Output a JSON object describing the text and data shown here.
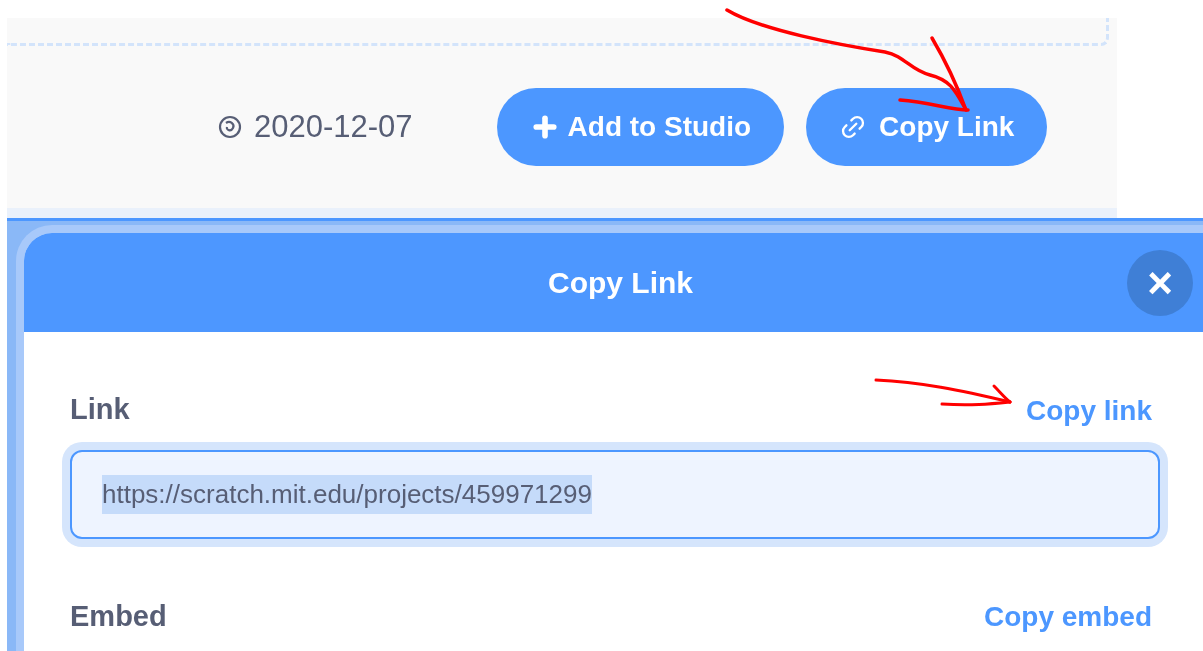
{
  "project_bar": {
    "date": "2020-12-07",
    "buttons": [
      {
        "kind": "add",
        "label": "Add to Studio"
      },
      {
        "kind": "link",
        "label": "Copy Link"
      }
    ]
  },
  "dialog": {
    "title": "Copy Link",
    "close": "×",
    "sections": [
      {
        "label": "Link",
        "action": "Copy link",
        "value": "https://scratch.mit.edu/projects/459971299",
        "text_selected": true
      },
      {
        "label": "Embed",
        "action": "Copy embed"
      }
    ]
  },
  "annotations": [
    {
      "kind": "arrow"
    },
    {
      "kind": "arrow"
    }
  ]
}
